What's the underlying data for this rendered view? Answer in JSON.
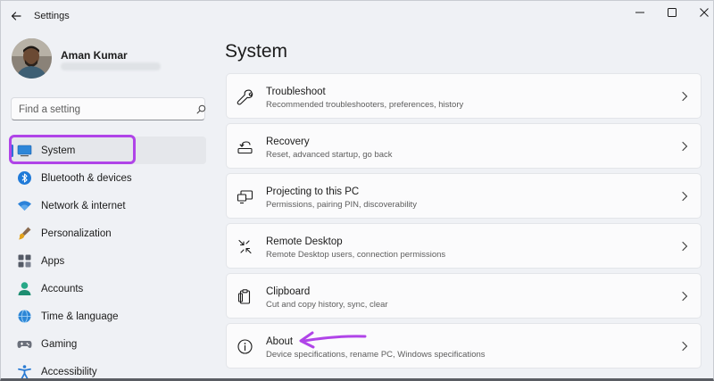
{
  "app": {
    "title": "Settings"
  },
  "profile": {
    "name": "Aman Kumar"
  },
  "search": {
    "placeholder": "Find a setting"
  },
  "nav": {
    "items": [
      {
        "label": "System"
      },
      {
        "label": "Bluetooth & devices"
      },
      {
        "label": "Network & internet"
      },
      {
        "label": "Personalization"
      },
      {
        "label": "Apps"
      },
      {
        "label": "Accounts"
      },
      {
        "label": "Time & language"
      },
      {
        "label": "Gaming"
      },
      {
        "label": "Accessibility"
      }
    ]
  },
  "main": {
    "title": "System",
    "cards": [
      {
        "title": "Troubleshoot",
        "desc": "Recommended troubleshooters, preferences, history"
      },
      {
        "title": "Recovery",
        "desc": "Reset, advanced startup, go back"
      },
      {
        "title": "Projecting to this PC",
        "desc": "Permissions, pairing PIN, discoverability"
      },
      {
        "title": "Remote Desktop",
        "desc": "Remote Desktop users, connection permissions"
      },
      {
        "title": "Clipboard",
        "desc": "Cut and copy history, sync, clear"
      },
      {
        "title": "About",
        "desc": "Device specifications, rename PC, Windows specifications"
      }
    ]
  },
  "colors": {
    "accent": "#2f6fd6",
    "annotation": "#b044e8"
  }
}
